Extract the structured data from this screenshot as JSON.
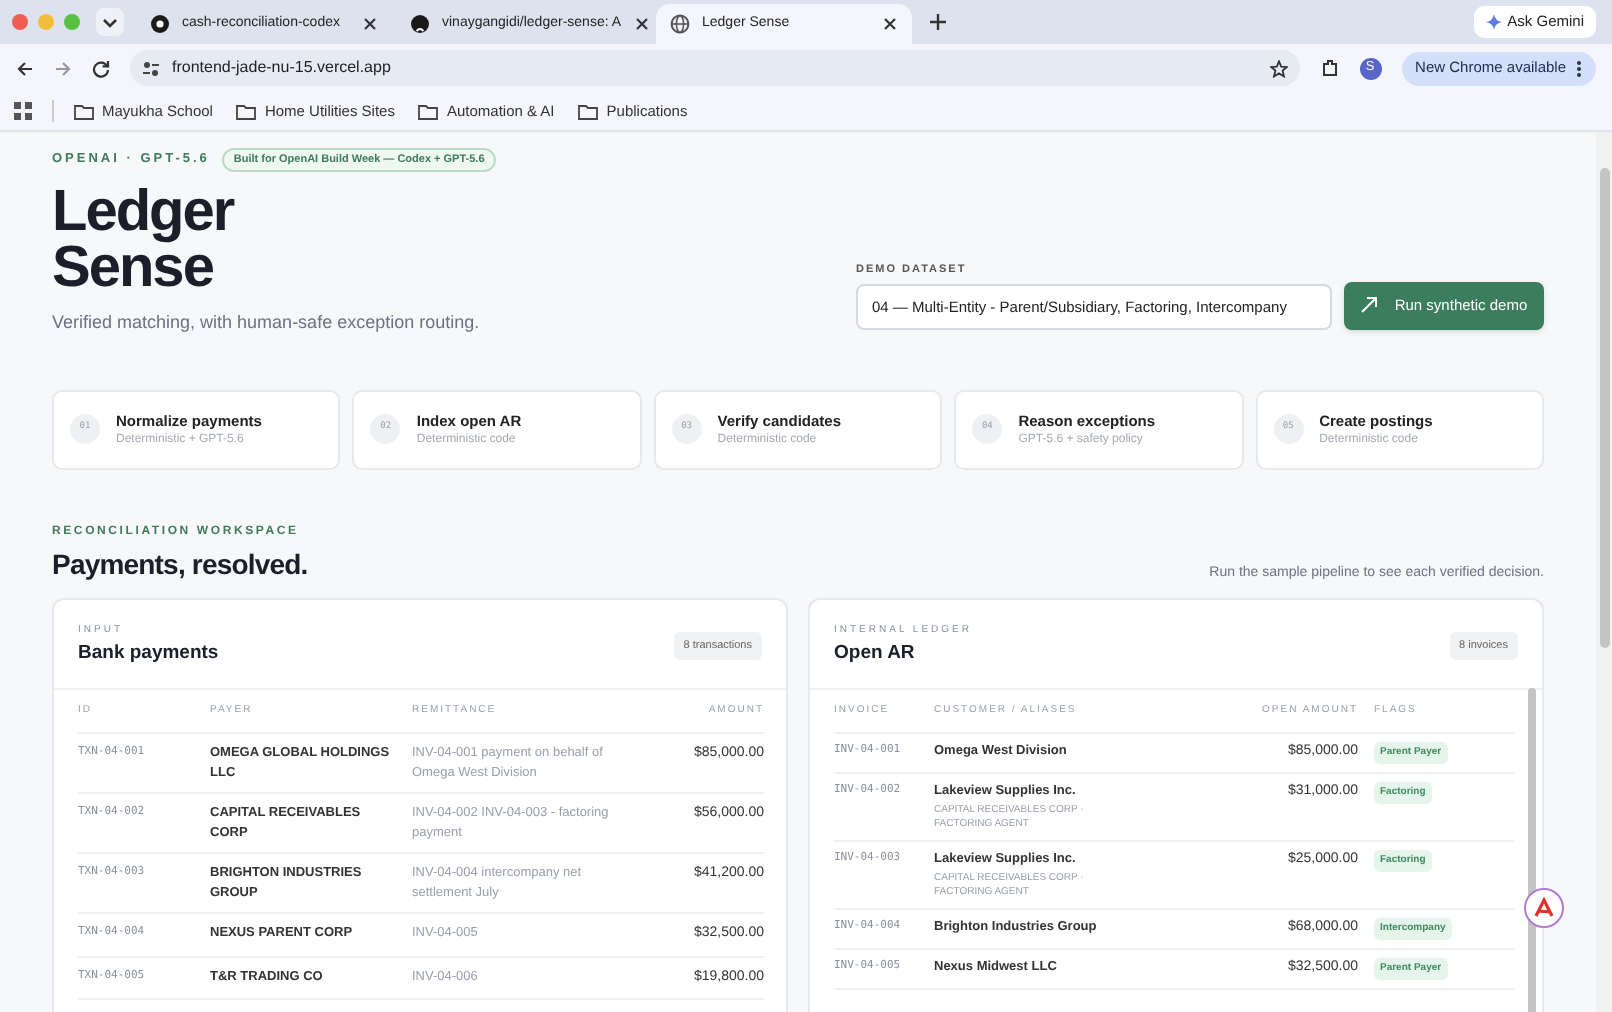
{
  "browser": {
    "tabs": [
      {
        "title": "cash-reconciliation-codex",
        "selected": false
      },
      {
        "title": "vinaygangidi/ledger-sense: A",
        "selected": false
      },
      {
        "title": "Ledger Sense",
        "selected": true
      }
    ],
    "ask_button": "Ask Gemini",
    "url": "frontend-jade-nu-15.vercel.app",
    "profile": "S",
    "update_button": "New Chrome available",
    "bookmarks": [
      "Mayukha School",
      "Home Utilities Sites",
      "Automation & AI",
      "Publications"
    ]
  },
  "header": {
    "eyebrow": "OPENAI · GPT-5.6",
    "badge": "Built for OpenAI Build Week — Codex + GPT-5.6",
    "title_lines": [
      "Ledger",
      "Sense"
    ],
    "subtitle": "Verified matching, with human-safe exception routing.",
    "dataset_label": "DEMO DATASET",
    "dataset_value": "04 — Multi-Entity - Parent/Subsidiary, Factoring, Intercompany",
    "run_button": "Run synthetic demo"
  },
  "steps": [
    {
      "number": "01",
      "title": "Normalize payments",
      "detail": "Deterministic + GPT-5.6"
    },
    {
      "number": "02",
      "title": "Index open AR",
      "detail": "Deterministic code"
    },
    {
      "number": "03",
      "title": "Verify candidates",
      "detail": "Deterministic code"
    },
    {
      "number": "04",
      "title": "Reason exceptions",
      "detail": "GPT-5.6 + safety policy"
    },
    {
      "number": "05",
      "title": "Create postings",
      "detail": "Deterministic code"
    }
  ],
  "workspace": {
    "eyebrow": "RECONCILIATION WORKSPACE",
    "title": "Payments, resolved.",
    "hint": "Run the sample pipeline to see each verified decision."
  },
  "bank_payments": {
    "eyebrow": "INPUT",
    "title": "Bank payments",
    "count": "8 transactions",
    "columns": [
      "ID",
      "PAYER",
      "REMITTANCE",
      "AMOUNT"
    ],
    "rows": [
      {
        "id": "TXN-04-001",
        "payer": "OMEGA GLOBAL HOLDINGS LLC",
        "remittance": "INV-04-001 payment on behalf of Omega West Division",
        "amount": "$85,000.00"
      },
      {
        "id": "TXN-04-002",
        "payer": "CAPITAL RECEIVABLES CORP",
        "remittance": "INV-04-002 INV-04-003 - factoring payment",
        "amount": "$56,000.00"
      },
      {
        "id": "TXN-04-003",
        "payer": "BRIGHTON INDUSTRIES GROUP",
        "remittance": "INV-04-004 intercompany net settlement July",
        "amount": "$41,200.00"
      },
      {
        "id": "TXN-04-004",
        "payer": "NEXUS PARENT CORP",
        "remittance": "INV-04-005",
        "amount": "$32,500.00"
      },
      {
        "id": "TXN-04-005",
        "payer": "T&R TRADING CO",
        "remittance": "INV-04-006",
        "amount": "$19,800.00"
      }
    ]
  },
  "open_ar": {
    "eyebrow": "INTERNAL LEDGER",
    "title": "Open AR",
    "count": "8 invoices",
    "columns": [
      "INVOICE",
      "CUSTOMER / ALIASES",
      "OPEN AMOUNT",
      "FLAGS"
    ],
    "rows": [
      {
        "invoice": "INV-04-001",
        "customer": "Omega West Division",
        "amount": "$85,000.00",
        "flag": "Parent Payer"
      },
      {
        "invoice": "INV-04-002",
        "customer": "Lakeview Supplies Inc.",
        "aliases": "CAPITAL RECEIVABLES CORP · FACTORING AGENT",
        "amount": "$31,000.00",
        "flag": "Factoring"
      },
      {
        "invoice": "INV-04-003",
        "customer": "Lakeview Supplies Inc.",
        "aliases": "CAPITAL RECEIVABLES CORP · FACTORING AGENT",
        "amount": "$25,000.00",
        "flag": "Factoring"
      },
      {
        "invoice": "INV-04-004",
        "customer": "Brighton Industries Group",
        "amount": "$68,000.00",
        "flag": "Intercompany"
      },
      {
        "invoice": "INV-04-005",
        "customer": "Nexus Midwest LLC",
        "amount": "$32,500.00",
        "flag": "Parent Payer"
      }
    ]
  }
}
